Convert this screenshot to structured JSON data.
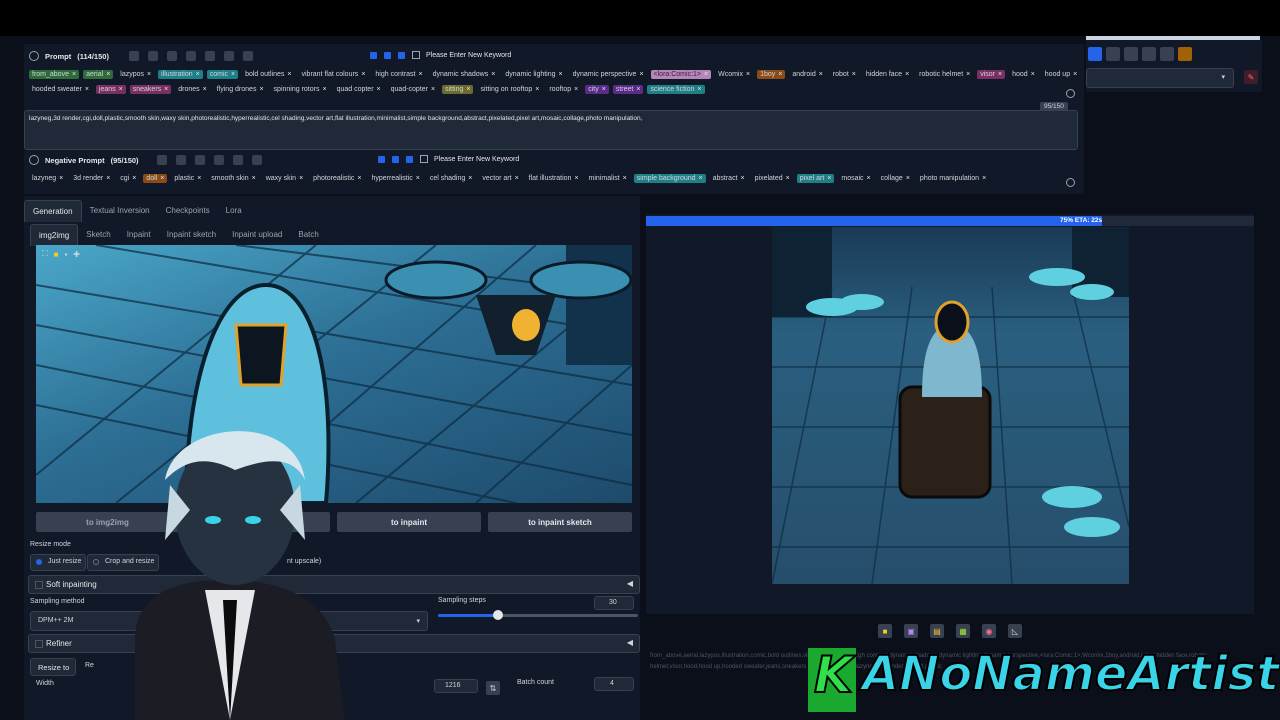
{
  "prompt": {
    "title": "Prompt",
    "count": "(114/150)",
    "keyword_placeholder": "Please Enter New Keyword",
    "token_counter": "95/150",
    "text": "lazyneg,3d render,cgi,doll,plastic,smooth skin,waxy skin,photorealistic,hyperrealistic,cel shading,vector art,flat illustration,minimalist,simple background,abstract,pixelated,pixel art,mosaic,collage,photo manipulation,",
    "tags_row1": [
      {
        "text": "from_above",
        "c": "g"
      },
      {
        "text": "aerial",
        "c": "g"
      },
      {
        "text": "lazypos",
        "c": ""
      },
      {
        "text": "illustration",
        "c": "t"
      },
      {
        "text": "comic",
        "c": "t"
      },
      {
        "text": "bold outlines",
        "c": ""
      },
      {
        "text": "vibrant flat colours",
        "c": ""
      },
      {
        "text": "high contrast",
        "c": ""
      },
      {
        "text": "dynamic shadows",
        "c": ""
      },
      {
        "text": "dynamic lighting",
        "c": ""
      },
      {
        "text": "dynamic perspective",
        "c": ""
      },
      {
        "text": "<lora:Comic:1>",
        "c": "lp"
      },
      {
        "text": "Wcomix",
        "c": ""
      },
      {
        "text": "1boy",
        "c": "o"
      },
      {
        "text": "android",
        "c": ""
      },
      {
        "text": "robot",
        "c": ""
      },
      {
        "text": "hidden face",
        "c": ""
      },
      {
        "text": "robotic helmet",
        "c": ""
      },
      {
        "text": "visor",
        "c": "p"
      },
      {
        "text": "hood",
        "c": ""
      },
      {
        "text": "hood up",
        "c": ""
      }
    ],
    "tags_row2": [
      {
        "text": "hooded sweater",
        "c": ""
      },
      {
        "text": "jeans",
        "c": "p"
      },
      {
        "text": "sneakers",
        "c": "p"
      },
      {
        "text": "drones",
        "c": ""
      },
      {
        "text": "flying drones",
        "c": ""
      },
      {
        "text": "spinning rotors",
        "c": ""
      },
      {
        "text": "quad copter",
        "c": ""
      },
      {
        "text": "quad-copter",
        "c": ""
      },
      {
        "text": "sitting",
        "c": "y"
      },
      {
        "text": "sitting on rooftop",
        "c": ""
      },
      {
        "text": "rooftop",
        "c": ""
      },
      {
        "text": "city",
        "c": "v"
      },
      {
        "text": "street",
        "c": "v"
      },
      {
        "text": "science fiction",
        "c": "t"
      }
    ]
  },
  "negative": {
    "title": "Negative Prompt",
    "count": "(95/150)",
    "keyword_placeholder": "Please Enter New Keyword",
    "tags": [
      {
        "text": "lazyneg",
        "c": ""
      },
      {
        "text": "3d render",
        "c": ""
      },
      {
        "text": "cgi",
        "c": ""
      },
      {
        "text": "doll",
        "c": "o"
      },
      {
        "text": "plastic",
        "c": ""
      },
      {
        "text": "smooth skin",
        "c": ""
      },
      {
        "text": "waxy skin",
        "c": ""
      },
      {
        "text": "photorealistic",
        "c": ""
      },
      {
        "text": "hyperrealistic",
        "c": ""
      },
      {
        "text": "cel shading",
        "c": ""
      },
      {
        "text": "vector art",
        "c": ""
      },
      {
        "text": "flat illustration",
        "c": ""
      },
      {
        "text": "minimalist",
        "c": ""
      },
      {
        "text": "simple background",
        "c": "t"
      },
      {
        "text": "abstract",
        "c": ""
      },
      {
        "text": "pixelated",
        "c": ""
      },
      {
        "text": "pixel art",
        "c": "t"
      },
      {
        "text": "mosaic",
        "c": ""
      },
      {
        "text": "collage",
        "c": ""
      },
      {
        "text": "photo manipulation",
        "c": ""
      }
    ]
  },
  "main_tabs": [
    "Generation",
    "Textual Inversion",
    "Checkpoints",
    "Lora"
  ],
  "sub_tabs": [
    "img2img",
    "Sketch",
    "Inpaint",
    "Inpaint sketch",
    "Inpaint upload",
    "Batch"
  ],
  "send_buttons": {
    "img2img": "to img2img",
    "inpaint": "to inpaint",
    "inpaint_sketch": "to inpaint sketch"
  },
  "resize": {
    "label": "Resize mode",
    "options": [
      "Just resize",
      "Crop and resize",
      "nt upscale)"
    ],
    "soft_inpainting": "Soft inpainting",
    "sampling_method_label": "Sampling method",
    "sampling_method": "DPM++ 2M",
    "sampling_steps_label": "Sampling steps",
    "sampling_steps": "30",
    "sampling_steps_fraction": 0.3,
    "refiner": "Refiner",
    "resize_to": "Resize to",
    "resize_by": "Re",
    "width_label": "Width",
    "width": "1216",
    "batch_count_label": "Batch count",
    "batch_count": "4"
  },
  "progress": {
    "text": "75% ETA: 22s",
    "fraction": 0.75
  },
  "output_info_text": "from_above,aerial,lazypos,illustration,comic,bold outlines,vibrant flat colours,high contrast,dynamic shadows,dynamic lighting,dynamic perspective,<lora:Comic:1>,Wcomix,1boy,android,robot,hidden face,robotic helmet,visor,hood,hood up,hooded sweater,jeans,sneakers Negative prompt: lazyneg,3d render,cgi,doll,plastic",
  "watermark": {
    "k": "K",
    "name": "ANoNameArtist"
  },
  "colors": {
    "accent": "#2563eb",
    "bg": "#0b0f19",
    "panel": "#111827",
    "wm_green": "#2fe04a",
    "wm_cyan": "#39d4e8"
  }
}
